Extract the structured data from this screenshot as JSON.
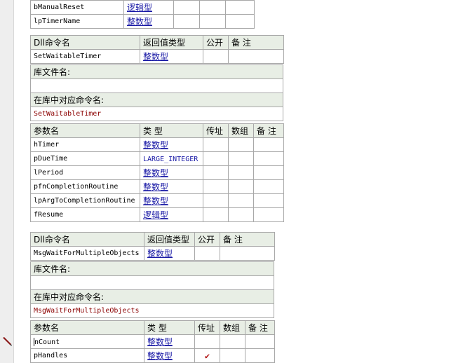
{
  "top_params": [
    {
      "name": "bManualReset",
      "type": "逻辑型"
    },
    {
      "name": "lpTimerName",
      "type": "整数型"
    }
  ],
  "headers": {
    "dll_name": "Dll命令名",
    "return_type": "返回值类型",
    "public": "公开",
    "remark": "备 注",
    "lib_file": "库文件名:",
    "lib_cmd": "在库中对应命令名:",
    "param_name": "参数名",
    "type": "类 型",
    "by_ref": "传址",
    "array": "数组"
  },
  "dll1": {
    "name": "SetWaitableTimer",
    "return_type": "整数型",
    "lib_file": "",
    "lib_cmd": "SetWaitableTimer",
    "params": [
      {
        "name": "hTimer",
        "type": "整数型",
        "by_ref": ""
      },
      {
        "name": "pDueTime",
        "type": "LARGE_INTEGER",
        "by_ref": ""
      },
      {
        "name": "lPeriod",
        "type": "整数型",
        "by_ref": ""
      },
      {
        "name": "pfnCompletionRoutine",
        "type": "整数型",
        "by_ref": ""
      },
      {
        "name": "lpArgToCompletionRoutine",
        "type": "整数型",
        "by_ref": ""
      },
      {
        "name": "fResume",
        "type": "逻辑型",
        "by_ref": ""
      }
    ]
  },
  "dll2": {
    "name": "MsgWaitForMultipleObjects",
    "return_type": "整数型",
    "lib_file": "",
    "lib_cmd": "MsgWaitForMultipleObjects",
    "params": [
      {
        "name": "nCount",
        "type": "整数型",
        "by_ref": ""
      },
      {
        "name": "pHandles",
        "type": "整数型",
        "by_ref": "✔"
      }
    ]
  },
  "icons": {
    "edit_marker": "pencil-icon",
    "by_ref_mark": "check-icon"
  }
}
